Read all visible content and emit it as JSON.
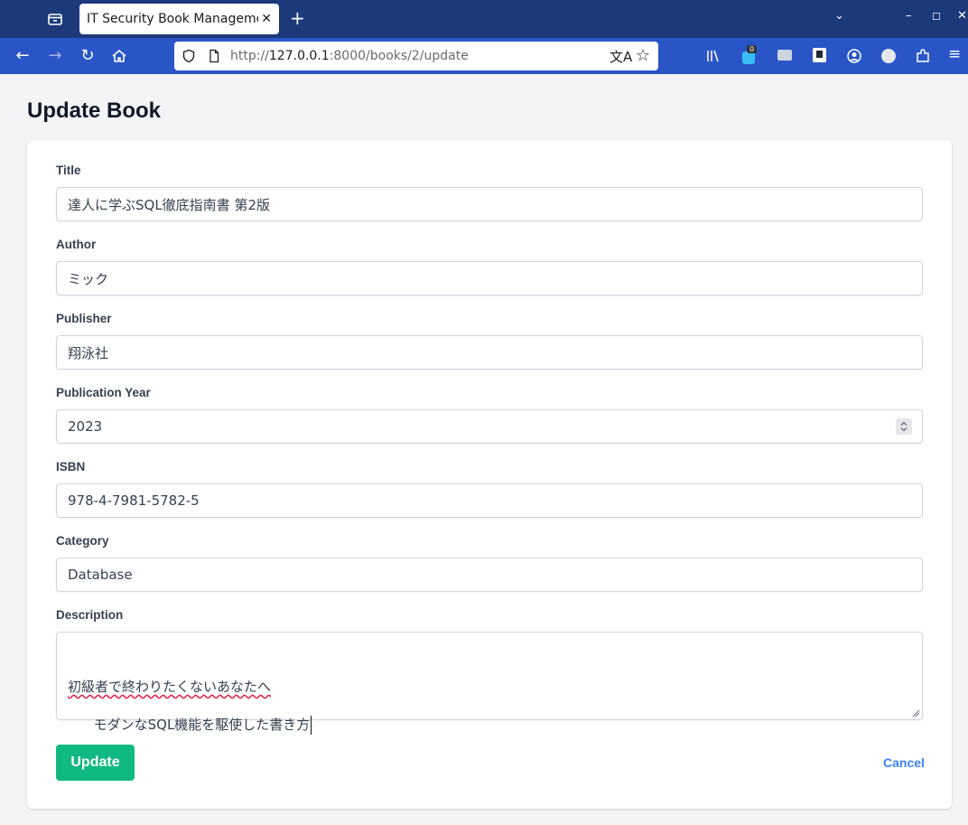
{
  "browser": {
    "tab_title": "IT Security Book Management",
    "url_host": "127.0.0.1",
    "url_prefix": "http://",
    "url_rest": ":8000/books/2/update",
    "notification_count": "0"
  },
  "page": {
    "title": "Update Book"
  },
  "form": {
    "title_label": "Title",
    "title_value": "達人に学ぶSQL徹底指南書 第2版",
    "author_label": "Author",
    "author_value": "ミック",
    "publisher_label": "Publisher",
    "publisher_value": "翔泳社",
    "year_label": "Publication Year",
    "year_value": "2023",
    "isbn_label": "ISBN",
    "isbn_value": "978-4-7981-5782-5",
    "category_label": "Category",
    "category_value": "Database",
    "description_label": "Description",
    "description_line1": "初級者で終わりたくないあなたへ",
    "description_line2": "モダンなSQL機能を駆使した書き方",
    "update_label": "Update",
    "cancel_label": "Cancel"
  },
  "icons": {
    "back": "arrow-left-icon",
    "forward": "arrow-right-icon",
    "reload": "reload-icon",
    "home": "home-icon",
    "shield": "shield-icon",
    "page": "page-icon",
    "translate": "translate-icon",
    "bookmark": "star-icon"
  },
  "colors": {
    "accent": "#10b981",
    "link": "#3b82f6",
    "tabbar": "#1c3a7a",
    "navbar": "#2a55c7"
  }
}
